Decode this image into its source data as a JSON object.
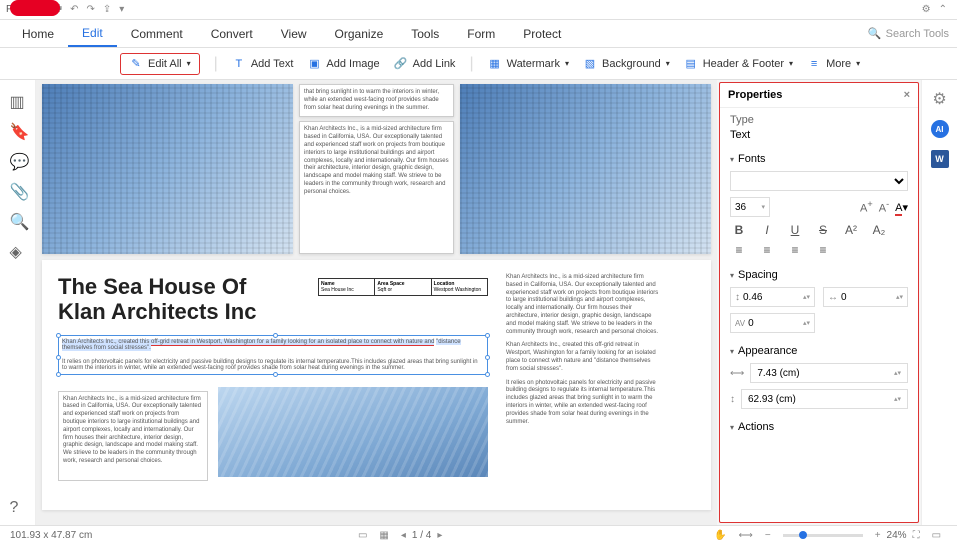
{
  "topbar": {
    "file": "File"
  },
  "tabs": [
    "Home",
    "Edit",
    "Comment",
    "Convert",
    "View",
    "Organize",
    "Tools",
    "Form",
    "Protect"
  ],
  "active_tab": "Edit",
  "search_placeholder": "Search Tools",
  "toolbar": {
    "edit_all": "Edit All",
    "add_text": "Add Text",
    "add_image": "Add Image",
    "add_link": "Add Link",
    "watermark": "Watermark",
    "background": "Background",
    "header_footer": "Header & Footer",
    "more": "More"
  },
  "doc": {
    "title_l1": "The Sea House Of",
    "title_l2": "Klan Architects Inc",
    "para_block": "that bring sunlight in to warm the interiors in winter, while an extended west-facing roof provides shade from solar heat during evenings in the summer.",
    "company": "Khan Architects Inc., is a mid-sized architecture firm based in California, USA. Our exceptionally talented and experienced staff work on projects from boutique interiors to large institutional buildings and airport complexes, locally and internationally. Our firm houses their architecture, interior design, graphic design, landscape and model making staff. We strieve to be leaders in the community through work, research and personal choices.",
    "sel_line1": "Khan Architects Inc., created this off-grid retreat in Westport, Washington for a family looking for an isolated place to connect with nature and",
    "sel_line2": "\"distance themselves from social stresses\".",
    "sel_line3": "It relies on photovoltaic panels for electricity and passive building designs to regulate its internal temperature.This includes glazed areas that bring sunlight in to warm the interiors in winter, while an extended west-facing roof provides shade from solar heat during evenings in the summer.",
    "right_para1": "Khan Architects Inc., is a mid-sized architecture firm based in California, USA. Our exceptionally talented and experienced staff work on projects from boutique interiors to large institutional buildings and airport complexes, locally and internationally. Our firm houses their architecture, interior design, graphic design, landscape and model making staff. We strieve to be leaders in the community through work, research and personal choices.",
    "right_para2": "Khan Architects Inc., created this off-grid retreat in Westport, Washington for a family looking for an isolated place to connect with nature and \"distance themselves from social stresses\".",
    "right_para3": "It relies on photovoltaic panels for electricity and passive building designs to regulate its internal temperature.This includes glazed areas that bring sunlight in to warm the interiors in winter, while an extended west-facing roof provides shade from solar heat during evenings in the summer.",
    "table": {
      "c1": "Name",
      "c2": "Area Space",
      "c3": "Location",
      "v1": "Sea House Inc",
      "v2": "Sqft or",
      "v3": "Westport Washington"
    }
  },
  "props": {
    "title": "Properties",
    "type_lbl": "Type",
    "type_val": "Text",
    "fonts_lbl": "Fonts",
    "size": "36",
    "spacing_lbl": "Spacing",
    "line_h": "0.46",
    "track": "0",
    "char": "0",
    "appearance_lbl": "Appearance",
    "w": "7.43 (cm)",
    "h": "62.93 (cm)",
    "actions_lbl": "Actions"
  },
  "status": {
    "cursor": "101.93 x 47.87 cm",
    "page": "1 / 4",
    "zoom": "24%"
  }
}
